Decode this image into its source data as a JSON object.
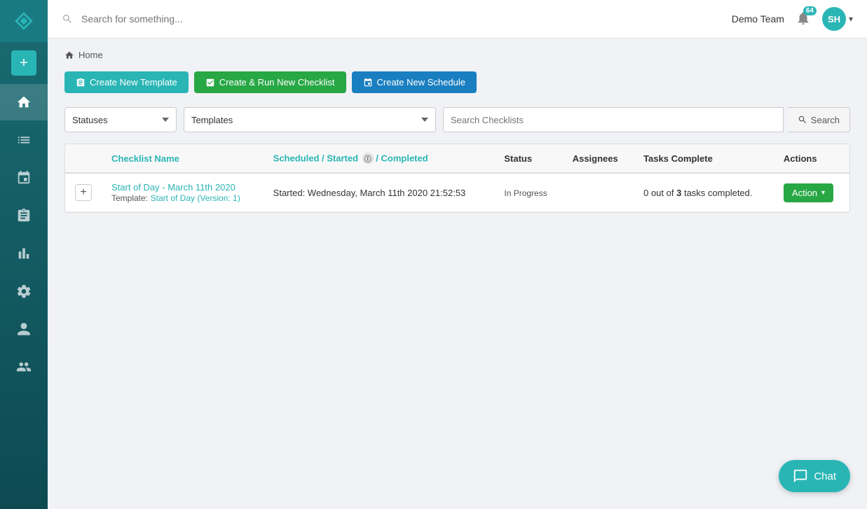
{
  "sidebar": {
    "items": [
      {
        "name": "home",
        "label": "Home",
        "active": true
      },
      {
        "name": "list",
        "label": "Checklists"
      },
      {
        "name": "calendar",
        "label": "Schedules"
      },
      {
        "name": "clipboard",
        "label": "Templates"
      },
      {
        "name": "bar-chart",
        "label": "Reports"
      },
      {
        "name": "wrench",
        "label": "Settings"
      },
      {
        "name": "user",
        "label": "Profile"
      },
      {
        "name": "users",
        "label": "Team"
      }
    ]
  },
  "topbar": {
    "search_placeholder": "Search for something...",
    "team_name": "Demo Team",
    "notification_count": "64",
    "avatar_initials": "SH"
  },
  "breadcrumb": {
    "home_label": "Home"
  },
  "buttons": {
    "create_template": "Create New Template",
    "create_run_checklist": "Create & Run New Checklist",
    "create_schedule": "Create New Schedule"
  },
  "filters": {
    "status_label": "Statuses",
    "template_label": "Templates",
    "search_placeholder": "Search Checklists",
    "search_button": "Search"
  },
  "table": {
    "columns": {
      "checklist_name": "Checklist Name",
      "scheduled_started_completed": "Scheduled / Started",
      "started_icon": "ⓘ",
      "completed": "/ Completed",
      "status": "Status",
      "assignees": "Assignees",
      "tasks_complete": "Tasks Complete",
      "actions": "Actions"
    },
    "rows": [
      {
        "id": 1,
        "name": "Start of Day - March 11th 2020",
        "template_prefix": "Template:",
        "template_name": "Start of Day (Version: 1)",
        "schedule_started": "Started: Wednesday, March 11th 2020 21:52:53",
        "status": "In Progress",
        "assignees": "",
        "tasks_done": "0",
        "tasks_total": "3",
        "tasks_label": "tasks completed.",
        "tasks_out_of": "out of",
        "action_label": "Action"
      }
    ]
  },
  "chat": {
    "label": "Chat"
  }
}
